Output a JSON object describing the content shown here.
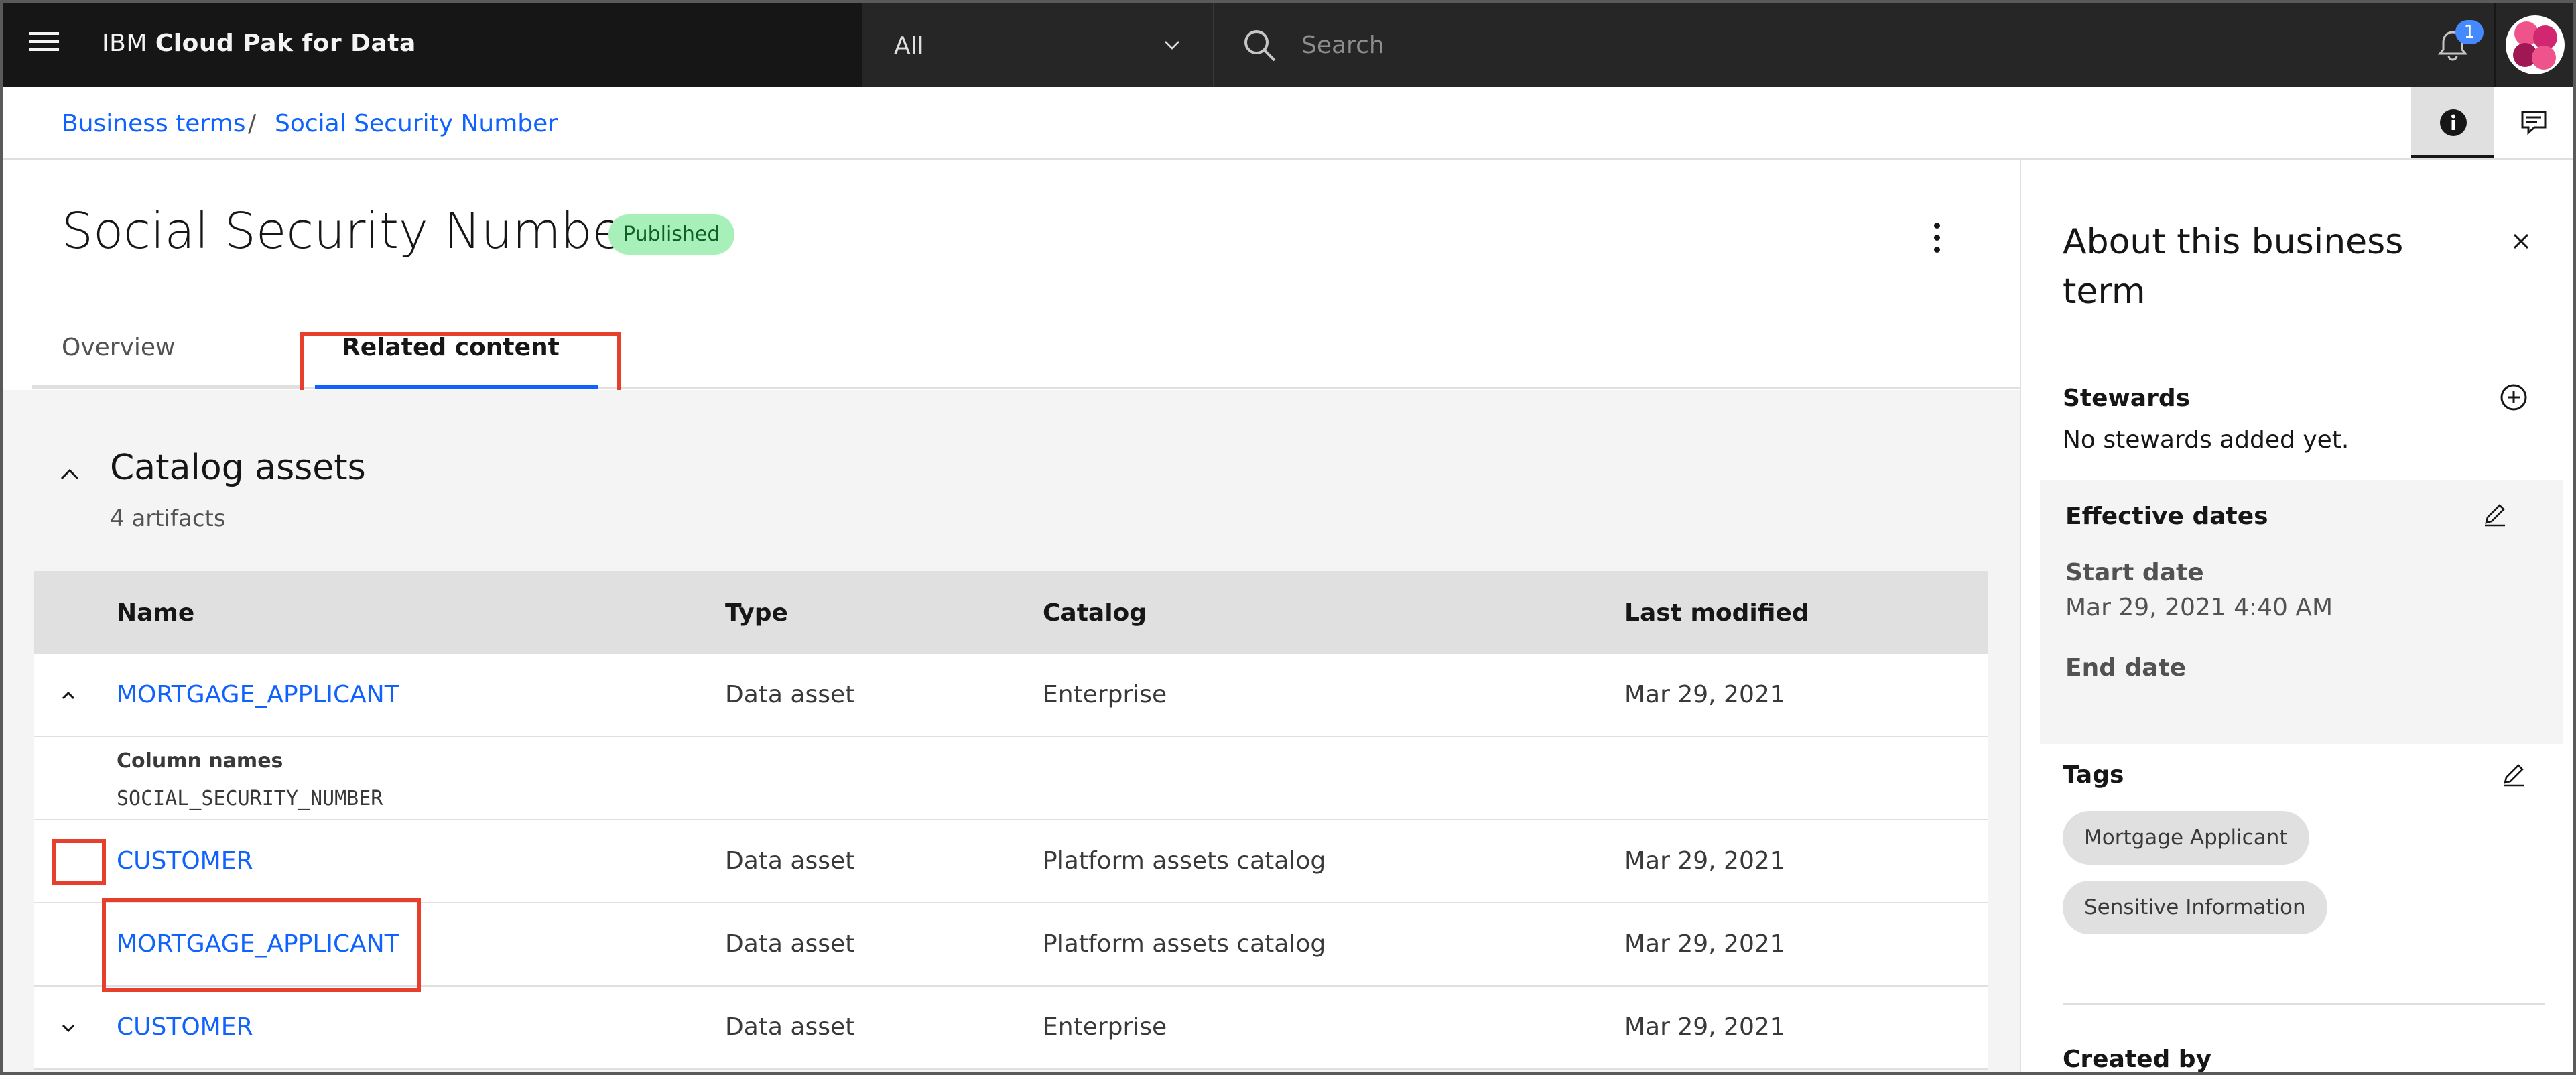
{
  "header": {
    "brand_prefix": "IBM ",
    "brand_name": "Cloud Pak for Data",
    "scope_value": "All",
    "search_placeholder": "Search",
    "notification_count": "1"
  },
  "breadcrumb": {
    "items": [
      {
        "label": "Business terms"
      },
      {
        "label": "Social Security Number"
      }
    ],
    "separator": "/"
  },
  "page": {
    "title": "Social Security Number",
    "status": "Published",
    "tabs": [
      {
        "label": "Overview",
        "selected": false
      },
      {
        "label": "Related content",
        "selected": true
      }
    ]
  },
  "section": {
    "title": "Catalog assets",
    "subtitle": "4 artifacts"
  },
  "table": {
    "columns": [
      "Name",
      "Type",
      "Catalog",
      "Last modified"
    ],
    "rows": [
      {
        "name": "MORTGAGE_APPLICANT",
        "type": "Data asset",
        "catalog": "Enterprise",
        "modified": "Mar 29, 2021",
        "expander": "up"
      },
      {
        "name": "CUSTOMER",
        "type": "Data asset",
        "catalog": "Platform assets catalog",
        "modified": "Mar 29, 2021",
        "expander": ""
      },
      {
        "name": "MORTGAGE_APPLICANT",
        "type": "Data asset",
        "catalog": "Platform assets catalog",
        "modified": "Mar 29, 2021",
        "expander": ""
      },
      {
        "name": "CUSTOMER",
        "type": "Data asset",
        "catalog": "Enterprise",
        "modified": "Mar 29, 2021",
        "expander": "down"
      }
    ],
    "expanded": {
      "label": "Column names",
      "value": "SOCIAL_SECURITY_NUMBER"
    }
  },
  "side_panel": {
    "title": "About this business term",
    "stewards_heading": "Stewards",
    "stewards_text": "No stewards added yet.",
    "dates_heading": "Effective dates",
    "start_label": "Start date",
    "start_value": "Mar 29, 2021 4:40 AM",
    "end_label": "End date",
    "tags_heading": "Tags",
    "tags": [
      "Mortgage Applicant",
      "Sensitive Information"
    ],
    "created_heading": "Created by"
  },
  "colors": {
    "accent": "#0f62fe",
    "highlight": "#e5402d",
    "status_bg": "#a7f0ba",
    "header_bg": "#161616"
  }
}
